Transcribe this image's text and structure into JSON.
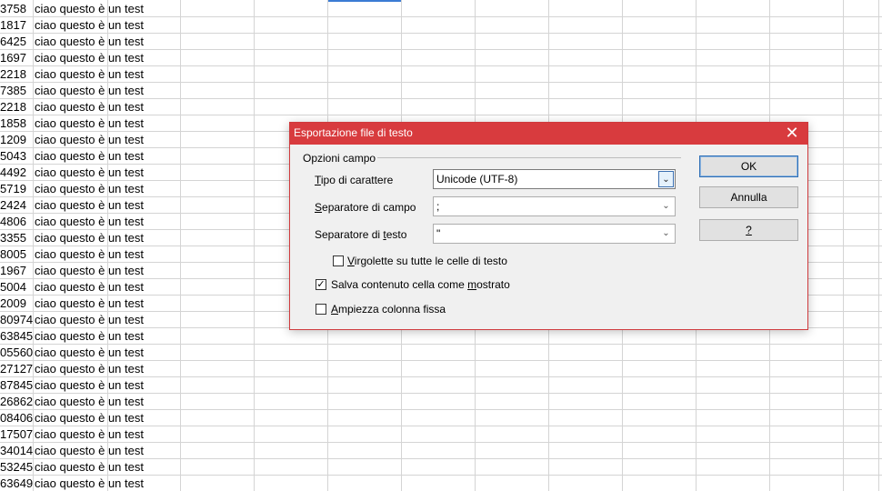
{
  "sheet": {
    "rows": [
      {
        "num": "3758",
        "text": "ciao questo è un test"
      },
      {
        "num": "1817",
        "text": "ciao questo è un test"
      },
      {
        "num": "6425",
        "text": "ciao questo è un test"
      },
      {
        "num": "1697",
        "text": "ciao questo è un test"
      },
      {
        "num": "2218",
        "text": "ciao questo è un test"
      },
      {
        "num": "7385",
        "text": "ciao questo è un test"
      },
      {
        "num": "2218",
        "text": "ciao questo è un test"
      },
      {
        "num": "1858",
        "text": "ciao questo è un test"
      },
      {
        "num": "1209",
        "text": "ciao questo è un test"
      },
      {
        "num": "5043",
        "text": "ciao questo è un test"
      },
      {
        "num": "4492",
        "text": "ciao questo è un test"
      },
      {
        "num": "5719",
        "text": "ciao questo è un test"
      },
      {
        "num": "2424",
        "text": "ciao questo è un test"
      },
      {
        "num": "4806",
        "text": "ciao questo è un test"
      },
      {
        "num": "3355",
        "text": "ciao questo è un test"
      },
      {
        "num": "8005",
        "text": "ciao questo è un test"
      },
      {
        "num": "1967",
        "text": "ciao questo è un test"
      },
      {
        "num": "5004",
        "text": "ciao questo è un test"
      },
      {
        "num": "2009",
        "text": "ciao questo è un test"
      },
      {
        "num": "80974",
        "text": "ciao questo è un test"
      },
      {
        "num": "63845",
        "text": "ciao questo è un test"
      },
      {
        "num": "05560",
        "text": "ciao questo è un test"
      },
      {
        "num": "27127",
        "text": "ciao questo è un test"
      },
      {
        "num": "87845",
        "text": "ciao questo è un test"
      },
      {
        "num": "26862",
        "text": "ciao questo è un test"
      },
      {
        "num": "08406",
        "text": "ciao questo è un test"
      },
      {
        "num": "17507",
        "text": "ciao questo è un test"
      },
      {
        "num": "34014",
        "text": "ciao questo è un test"
      },
      {
        "num": "53245",
        "text": "ciao questo è un test"
      },
      {
        "num": "63649",
        "text": "ciao questo è un test"
      }
    ]
  },
  "dialog": {
    "title": "Esportazione file di testo",
    "close_icon": "close-icon",
    "group_label": "Opzioni campo",
    "charset": {
      "label_u": "T",
      "label_rest": "ipo di carattere",
      "value": "Unicode (UTF-8)"
    },
    "field_sep": {
      "label_u": "S",
      "label_rest": "eparatore di campo",
      "value": ";"
    },
    "text_sep": {
      "label_pre": "Separatore di ",
      "label_u": "t",
      "label_rest": "esto",
      "value": "\""
    },
    "quote_all": {
      "label_u": "V",
      "label_rest": "irgolette su tutte le celle di testo",
      "checked": false
    },
    "save_as_shown": {
      "label_pre": "Salva contenuto cella come ",
      "label_u": "m",
      "label_rest": "ostrato",
      "checked": true
    },
    "fixed_width": {
      "label_u": "A",
      "label_rest": "mpiezza colonna fissa",
      "checked": false
    },
    "ok_label": "OK",
    "cancel_label": "Annulla",
    "help_label": "?"
  },
  "colors": {
    "titlebar": "#d83b3e",
    "accent": "#3b7bd4"
  }
}
